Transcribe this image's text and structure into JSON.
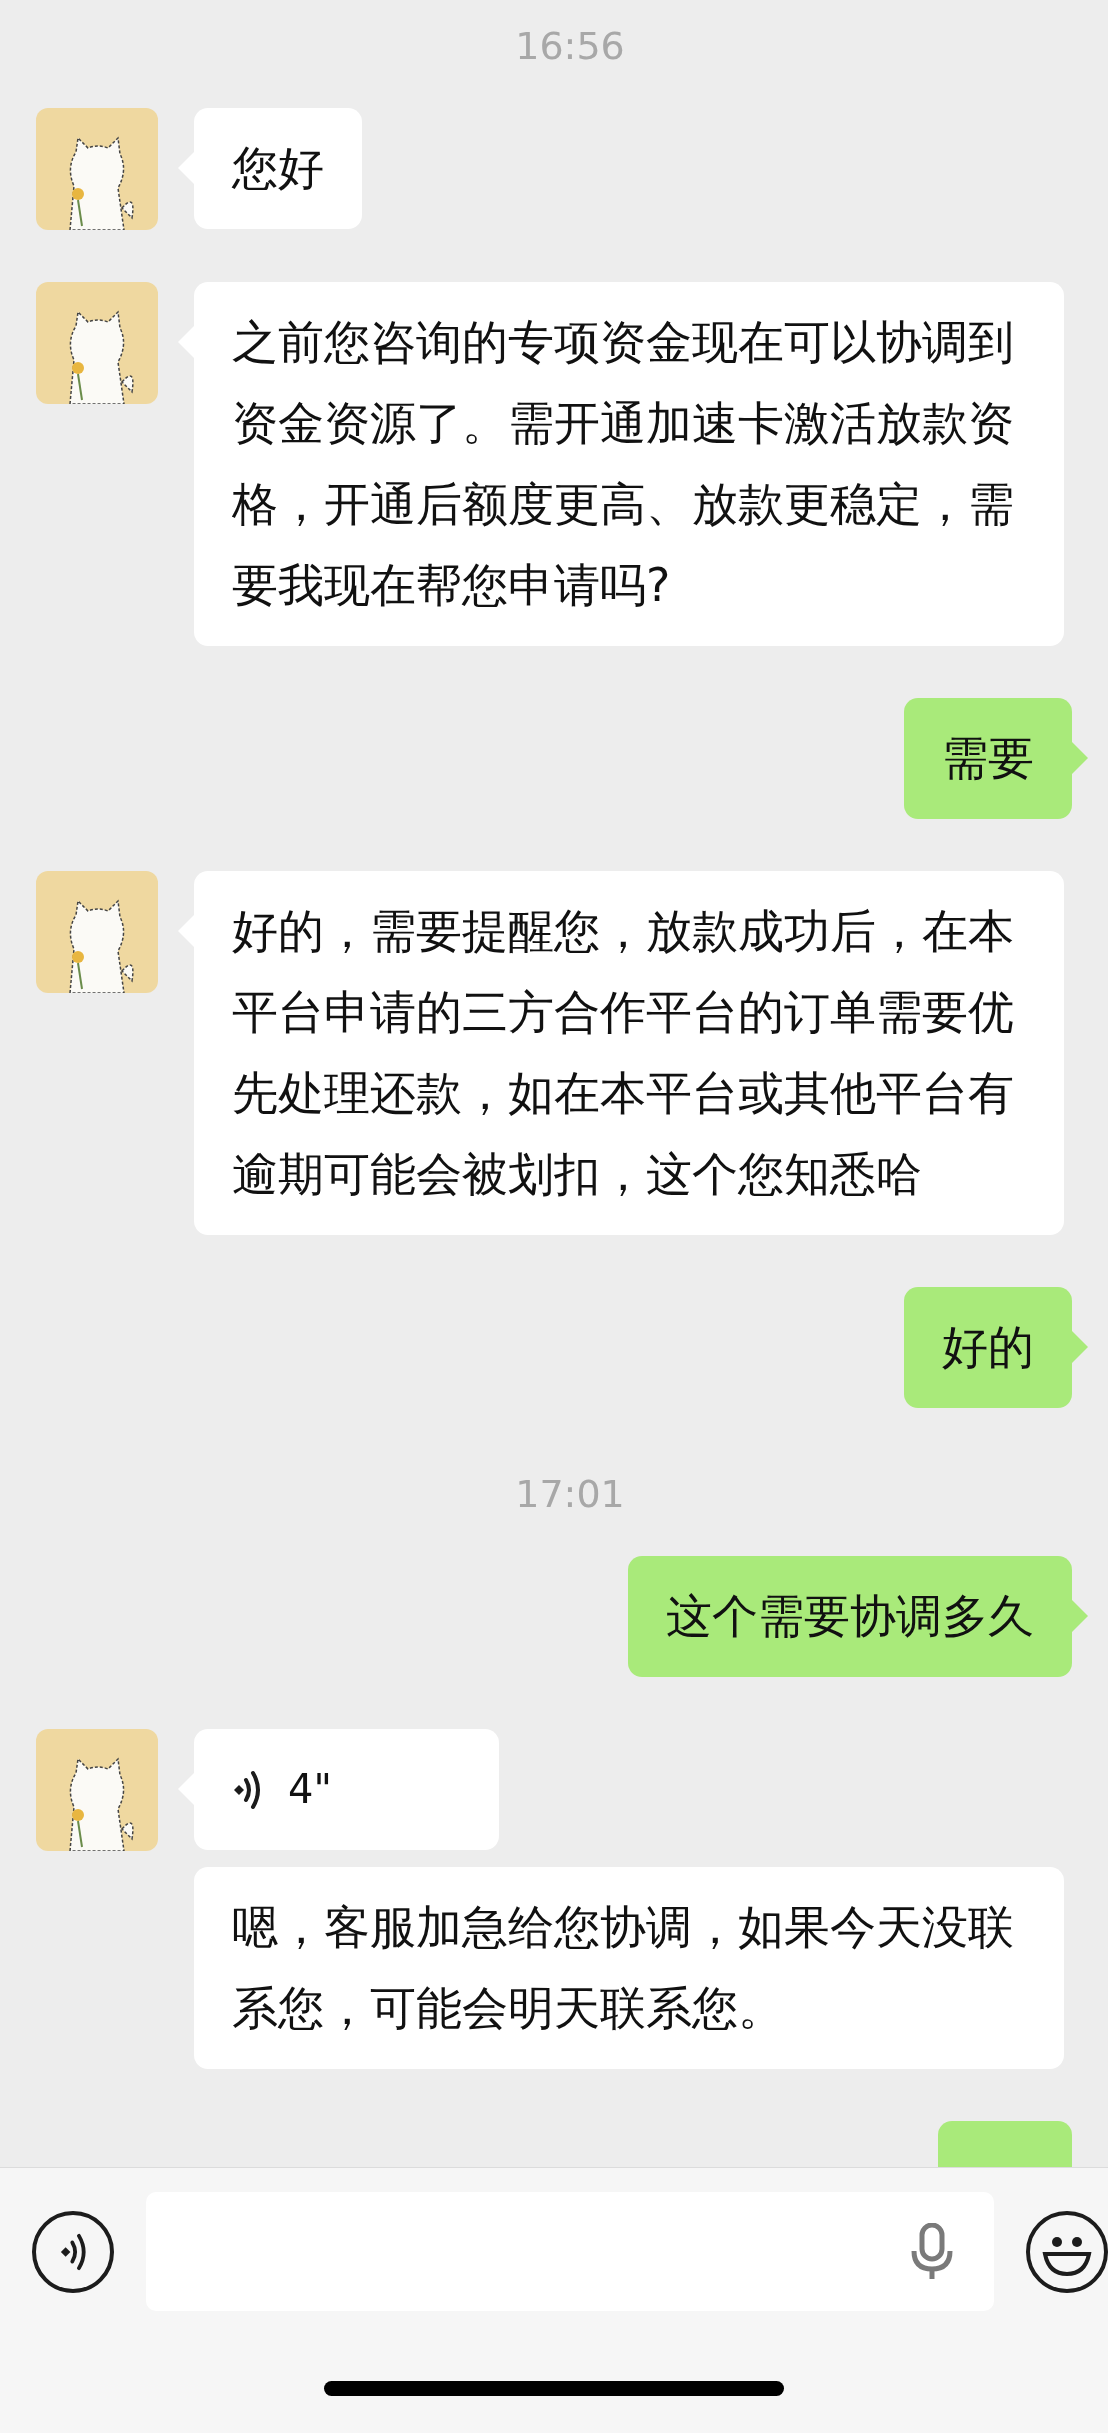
{
  "messages": [
    {
      "kind": "timestamp",
      "text": "16:56"
    },
    {
      "kind": "text",
      "outgoing": false,
      "text": "您好"
    },
    {
      "kind": "text",
      "outgoing": false,
      "text": "之前您咨询的专项资金现在可以协调到资金资源了。需开通加速卡激活放款资格，开通后额度更高、放款更稳定，需要我现在帮您申请吗?"
    },
    {
      "kind": "text",
      "outgoing": true,
      "text": "需要"
    },
    {
      "kind": "text",
      "outgoing": false,
      "text": "好的，需要提醒您，放款成功后，在本平台申请的三方合作平台的订单需要优先处理还款，如在本平台或其他平台有逾期可能会被划扣，这个您知悉哈"
    },
    {
      "kind": "text",
      "outgoing": true,
      "text": "好的"
    },
    {
      "kind": "timestamp",
      "text": "17:01"
    },
    {
      "kind": "text",
      "outgoing": true,
      "text": "这个需要协调多久"
    },
    {
      "kind": "voice",
      "outgoing": false,
      "duration": "4\""
    },
    {
      "kind": "text",
      "outgoing": false,
      "continued": true,
      "text": "嗯，客服加急给您协调，如果今天没联系您，可能会明天联系您。"
    },
    {
      "kind": "partial",
      "outgoing": true
    }
  ]
}
